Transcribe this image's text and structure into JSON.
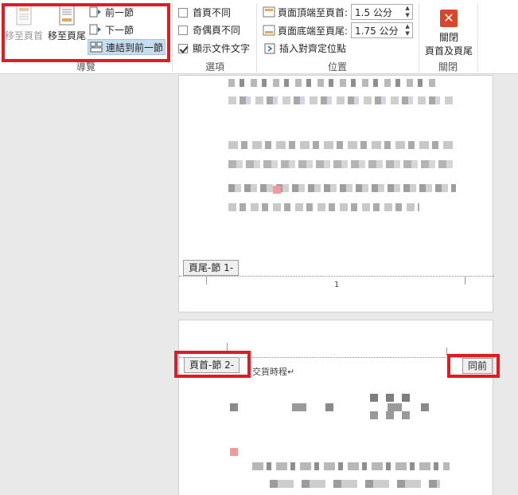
{
  "navigation": {
    "go_to_header": "移至頁首",
    "go_to_footer": "移至頁尾",
    "previous_section": "前一節",
    "next_section": "下一節",
    "link_to_previous": "連結到前一節",
    "group_label": "導覽"
  },
  "options": {
    "different_first_page": {
      "label": "首頁不同",
      "checked": false
    },
    "different_odd_even": {
      "label": "奇偶頁不同",
      "checked": false
    },
    "show_document_text": {
      "label": "顯示文件文字",
      "checked": true
    },
    "group_label": "選項"
  },
  "position": {
    "header_from_top_label": "頁面頂端至頁首:",
    "header_from_top_value": "1.5 公分",
    "footer_from_bottom_label": "頁面底端至頁尾:",
    "footer_from_bottom_value": "1.75 公分",
    "insert_alignment_tab": "插入對齊定位點",
    "group_label": "位置"
  },
  "close": {
    "label_line1": "關閉",
    "label_line2": "頁首及頁尾",
    "group_label": "關閉"
  },
  "document": {
    "footer_tag": "頁尾-節 1-",
    "page_number": "1",
    "header_tag": "頁首-節 2-",
    "header_text": "交貨時程↵",
    "same_as_previous": "同前"
  },
  "colors": {
    "highlight_frame": "#e01b24",
    "close_icon": "#d9472b",
    "active_button": "#c6dcf1"
  }
}
